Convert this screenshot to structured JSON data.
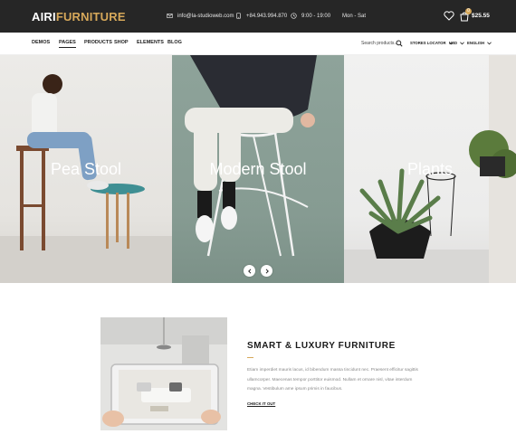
{
  "header": {
    "logo_part1": "AIRI",
    "logo_part2": "FURNITURE",
    "email": "info@la-studioweb.com",
    "phone": "+84.943.994.870",
    "hours": "9:00 - 19:00",
    "days": "Mon - Sat",
    "cart_count": "0",
    "cart_total": "$25.55"
  },
  "nav": {
    "items": [
      "DEMOS",
      "PAGES",
      "PRODUCTS",
      "SHOP",
      "ELEMENTS",
      "BLOG"
    ],
    "active": "PAGES",
    "search_placeholder": "Search products...",
    "stores_locator": "STORES LOCATOR",
    "currency": "USD",
    "language": "ENGLISH"
  },
  "hero": {
    "panels": [
      {
        "title": "Pea Stool"
      },
      {
        "title": "Modern Stool"
      },
      {
        "title": "Plants"
      }
    ]
  },
  "feature": {
    "title": "SMART & LUXURY FURNITURE",
    "text": "Etiam imperdiet mauris lacus, id bibendum massa tincidunt nec. Praesent efficitur sagittis ullamcorper. Maecenas tempor porttitor euismod. Nullam et ornare nisl, vitae interdum magna. Vestibulum ame ipsum primis in faucibus.",
    "link": "CHECK IT OUT"
  },
  "colors": {
    "topbar": "#262626",
    "accent": "#d6a85a",
    "panel_mid": "#8ea39a"
  },
  "icons": [
    "email-icon",
    "phone-icon",
    "clock-icon",
    "heart-icon",
    "cart-icon",
    "search-icon",
    "chevron-down-icon",
    "chevron-left-icon",
    "chevron-right-icon"
  ]
}
